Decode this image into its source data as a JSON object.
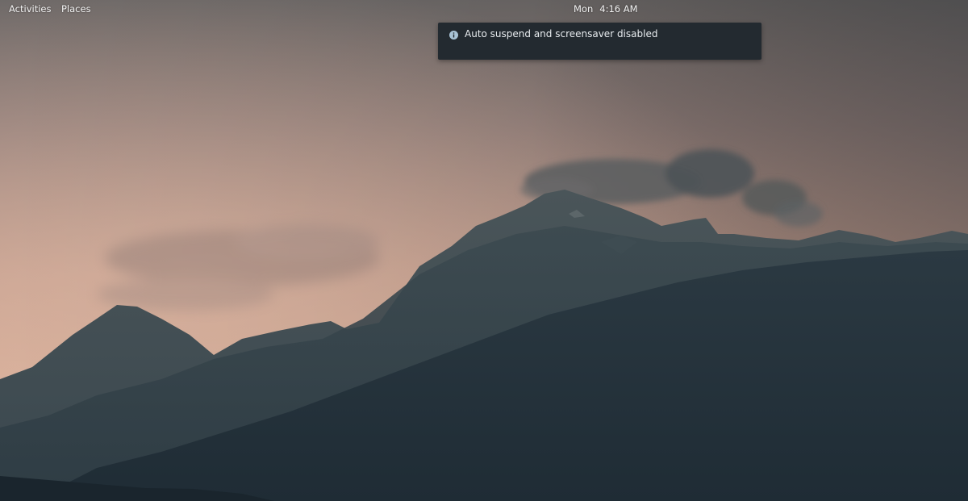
{
  "top_bar": {
    "activities_label": "Activities",
    "places_label": "Places",
    "clock": {
      "day": "Mon",
      "time": "4:16 AM"
    }
  },
  "notification": {
    "icon": "info-icon",
    "message": "Auto suspend and screensaver disabled"
  },
  "colors": {
    "notification_bg": "#232a30",
    "sky_top": "#6f6b69",
    "sky_glow": "#c9a695",
    "mountain_front": "#22313b"
  }
}
